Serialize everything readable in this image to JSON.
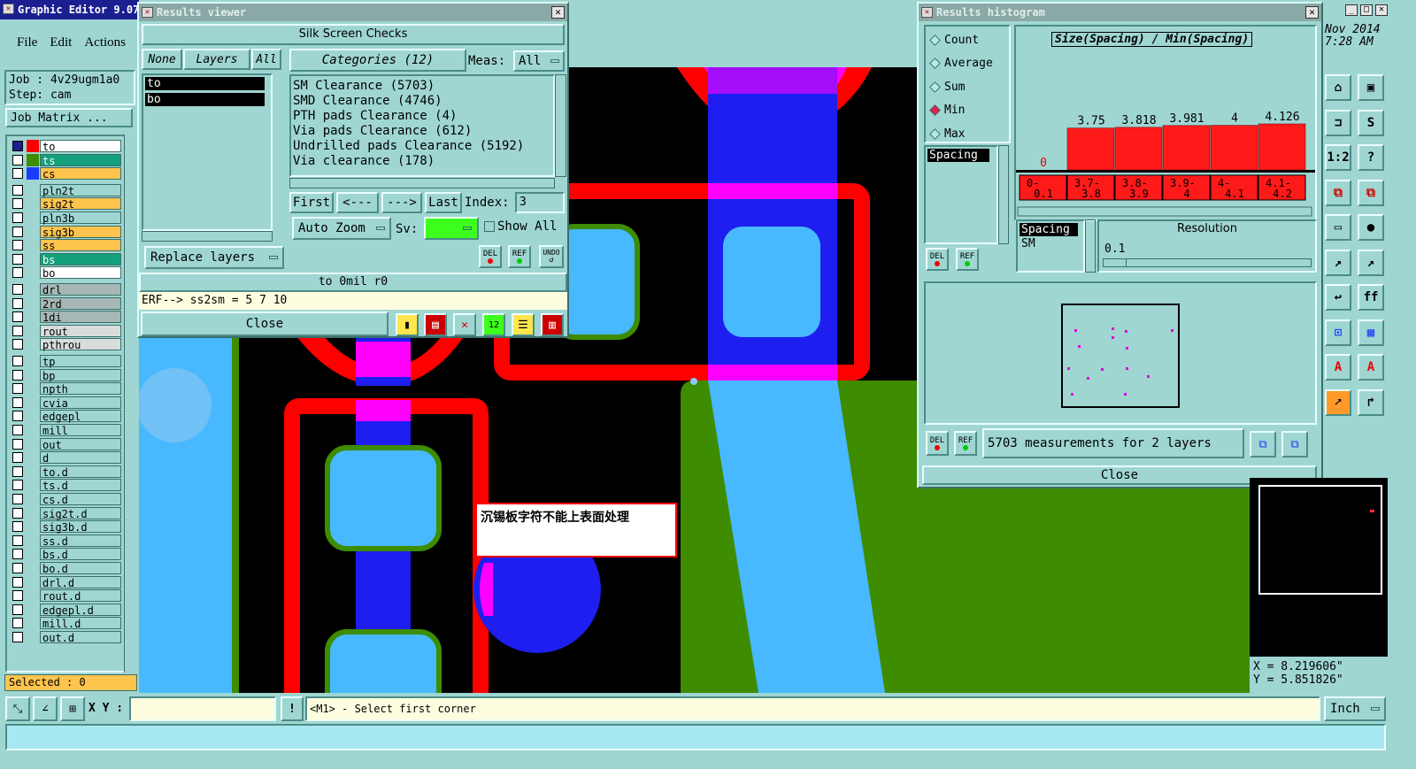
{
  "main_window": {
    "title": "Graphic Editor 9.07",
    "date": "Nov 2014",
    "time": "7:28 AM"
  },
  "menu": [
    "File",
    "Edit",
    "Actions"
  ],
  "job": {
    "job_label": "Job : 4v29ugm1a0",
    "step_label": "Step: cam",
    "job_matrix": "Job Matrix ..."
  },
  "layers": [
    {
      "name": "to",
      "color": "#ff0000",
      "checked": true,
      "state": "active"
    },
    {
      "name": "ts",
      "color": "#3e8c00",
      "checked": false,
      "state": "teal"
    },
    {
      "name": "cs",
      "color": "#1b3cff",
      "checked": false,
      "state": "orange"
    },
    {
      "name": "pln2t",
      "color": "",
      "checked": false,
      "state": "plain"
    },
    {
      "name": "sig2t",
      "color": "",
      "checked": false,
      "state": "orange"
    },
    {
      "name": "pln3b",
      "color": "",
      "checked": false,
      "state": "plain"
    },
    {
      "name": "sig3b",
      "color": "",
      "checked": false,
      "state": "orange"
    },
    {
      "name": "ss",
      "color": "",
      "checked": false,
      "state": "orange"
    },
    {
      "name": "bs",
      "color": "",
      "checked": false,
      "state": "teal"
    },
    {
      "name": "bo",
      "color": "",
      "checked": false,
      "state": "white"
    },
    {
      "name": "drl",
      "color": "",
      "checked": false,
      "state": "grey"
    },
    {
      "name": "2rd",
      "color": "",
      "checked": false,
      "state": "grey"
    },
    {
      "name": "1di",
      "color": "",
      "checked": false,
      "state": "grey"
    },
    {
      "name": "rout",
      "color": "",
      "checked": false,
      "state": "lightgrey"
    },
    {
      "name": "pthrou",
      "color": "",
      "checked": false,
      "state": "lightgrey"
    },
    {
      "name": "tp",
      "color": "",
      "checked": false,
      "state": "plain"
    },
    {
      "name": "bp",
      "color": "",
      "checked": false,
      "state": "plain"
    },
    {
      "name": "npth",
      "color": "",
      "checked": false,
      "state": "plain"
    },
    {
      "name": "cvia",
      "color": "",
      "checked": false,
      "state": "plain"
    },
    {
      "name": "edgepl",
      "color": "",
      "checked": false,
      "state": "plain"
    },
    {
      "name": "mill",
      "color": "",
      "checked": false,
      "state": "plain"
    },
    {
      "name": "out",
      "color": "",
      "checked": false,
      "state": "plain"
    },
    {
      "name": "d",
      "color": "",
      "checked": false,
      "state": "plain"
    },
    {
      "name": "to.d",
      "color": "",
      "checked": false,
      "state": "plain"
    },
    {
      "name": "ts.d",
      "color": "",
      "checked": false,
      "state": "plain"
    },
    {
      "name": "cs.d",
      "color": "",
      "checked": false,
      "state": "plain"
    },
    {
      "name": "sig2t.d",
      "color": "",
      "checked": false,
      "state": "plain"
    },
    {
      "name": "sig3b.d",
      "color": "",
      "checked": false,
      "state": "plain"
    },
    {
      "name": "ss.d",
      "color": "",
      "checked": false,
      "state": "plain"
    },
    {
      "name": "bs.d",
      "color": "",
      "checked": false,
      "state": "plain"
    },
    {
      "name": "bo.d",
      "color": "",
      "checked": false,
      "state": "plain"
    },
    {
      "name": "drl.d",
      "color": "",
      "checked": false,
      "state": "plain"
    },
    {
      "name": "rout.d",
      "color": "",
      "checked": false,
      "state": "plain"
    },
    {
      "name": "edgepl.d",
      "color": "",
      "checked": false,
      "state": "plain"
    },
    {
      "name": "mill.d",
      "color": "",
      "checked": false,
      "state": "plain"
    },
    {
      "name": "out.d",
      "color": "",
      "checked": false,
      "state": "plain"
    }
  ],
  "selected_text": "Selected : 0",
  "results_viewer": {
    "title": "Results viewer",
    "header": "Silk Screen Checks",
    "layer_buttons": [
      "None",
      "Layers",
      "All"
    ],
    "layers_list": [
      "to",
      "bo"
    ],
    "categories_label": "Categories (12)",
    "meas_label": "Meas:",
    "meas_value": "All",
    "categories": [
      "SM Clearance (5703)",
      "SMD Clearance (4746)",
      "PTH pads Clearance (4)",
      "Via pads Clearance (612)",
      "Undrilled pads Clearance (5192)",
      "Via clearance (178)"
    ],
    "nav": {
      "first": "First",
      "prev": "<---",
      "next": "--->",
      "last": "Last",
      "index_label": "Index:",
      "index_value": "3"
    },
    "auto_zoom": "Auto Zoom",
    "sv_label": "Sv:",
    "show_all": "Show All",
    "replace_layers": "Replace layers",
    "small_btns": [
      "DEL",
      "REF",
      "UNDO"
    ],
    "status_line": "to 0mil  r0",
    "erf_line": "ERF--> ss2sm = 5 7 10",
    "close": "Close"
  },
  "histogram": {
    "title": "Results histogram",
    "modes": [
      "Count",
      "Average",
      "Sum",
      "Min",
      "Max"
    ],
    "selected_mode": "Min",
    "field_label": "Spacing",
    "sub_labels": [
      "Spacing",
      "SM"
    ],
    "resolution_label": "Resolution",
    "resolution_value": "0.1",
    "small_btns": [
      "DEL",
      "REF"
    ],
    "summary": "5703 measurements for 2 layers",
    "close": "Close"
  },
  "chart_data": {
    "type": "bar",
    "title": "Size(Spacing) / Min(Spacing)",
    "categories": [
      "0-\n0.1",
      "3.7-\n3.8",
      "3.8-\n3.9",
      "3.9-\n4",
      "4-\n4.1",
      "4.1-\n4.2"
    ],
    "values": [
      0,
      3.75,
      3.818,
      3.981,
      4,
      4.126
    ],
    "labels": [
      "0",
      "3.75",
      "3.818",
      "3.981",
      "4",
      "4.126"
    ],
    "bar_color": "#ff1a1a"
  },
  "canvas": {
    "annotation": "沉锡板字符不能上表面处理",
    "coord_x": "X = 8.219606\"",
    "coord_y": "Y = 5.851826\""
  },
  "toolbar_right": [
    "home",
    "frame",
    "split",
    "S",
    "1:2",
    "?",
    "layers",
    "layers2",
    "ruler",
    "dot",
    "snap1",
    "snap2",
    "return",
    "fF",
    "measure",
    "blocks",
    "arcA",
    "arcB",
    "pointer",
    "pointer2"
  ],
  "bottom": {
    "xy_label": "X Y :",
    "xy_value": "",
    "warn": "!",
    "prompt": "<M1> - Select first corner",
    "units": "Inch"
  }
}
